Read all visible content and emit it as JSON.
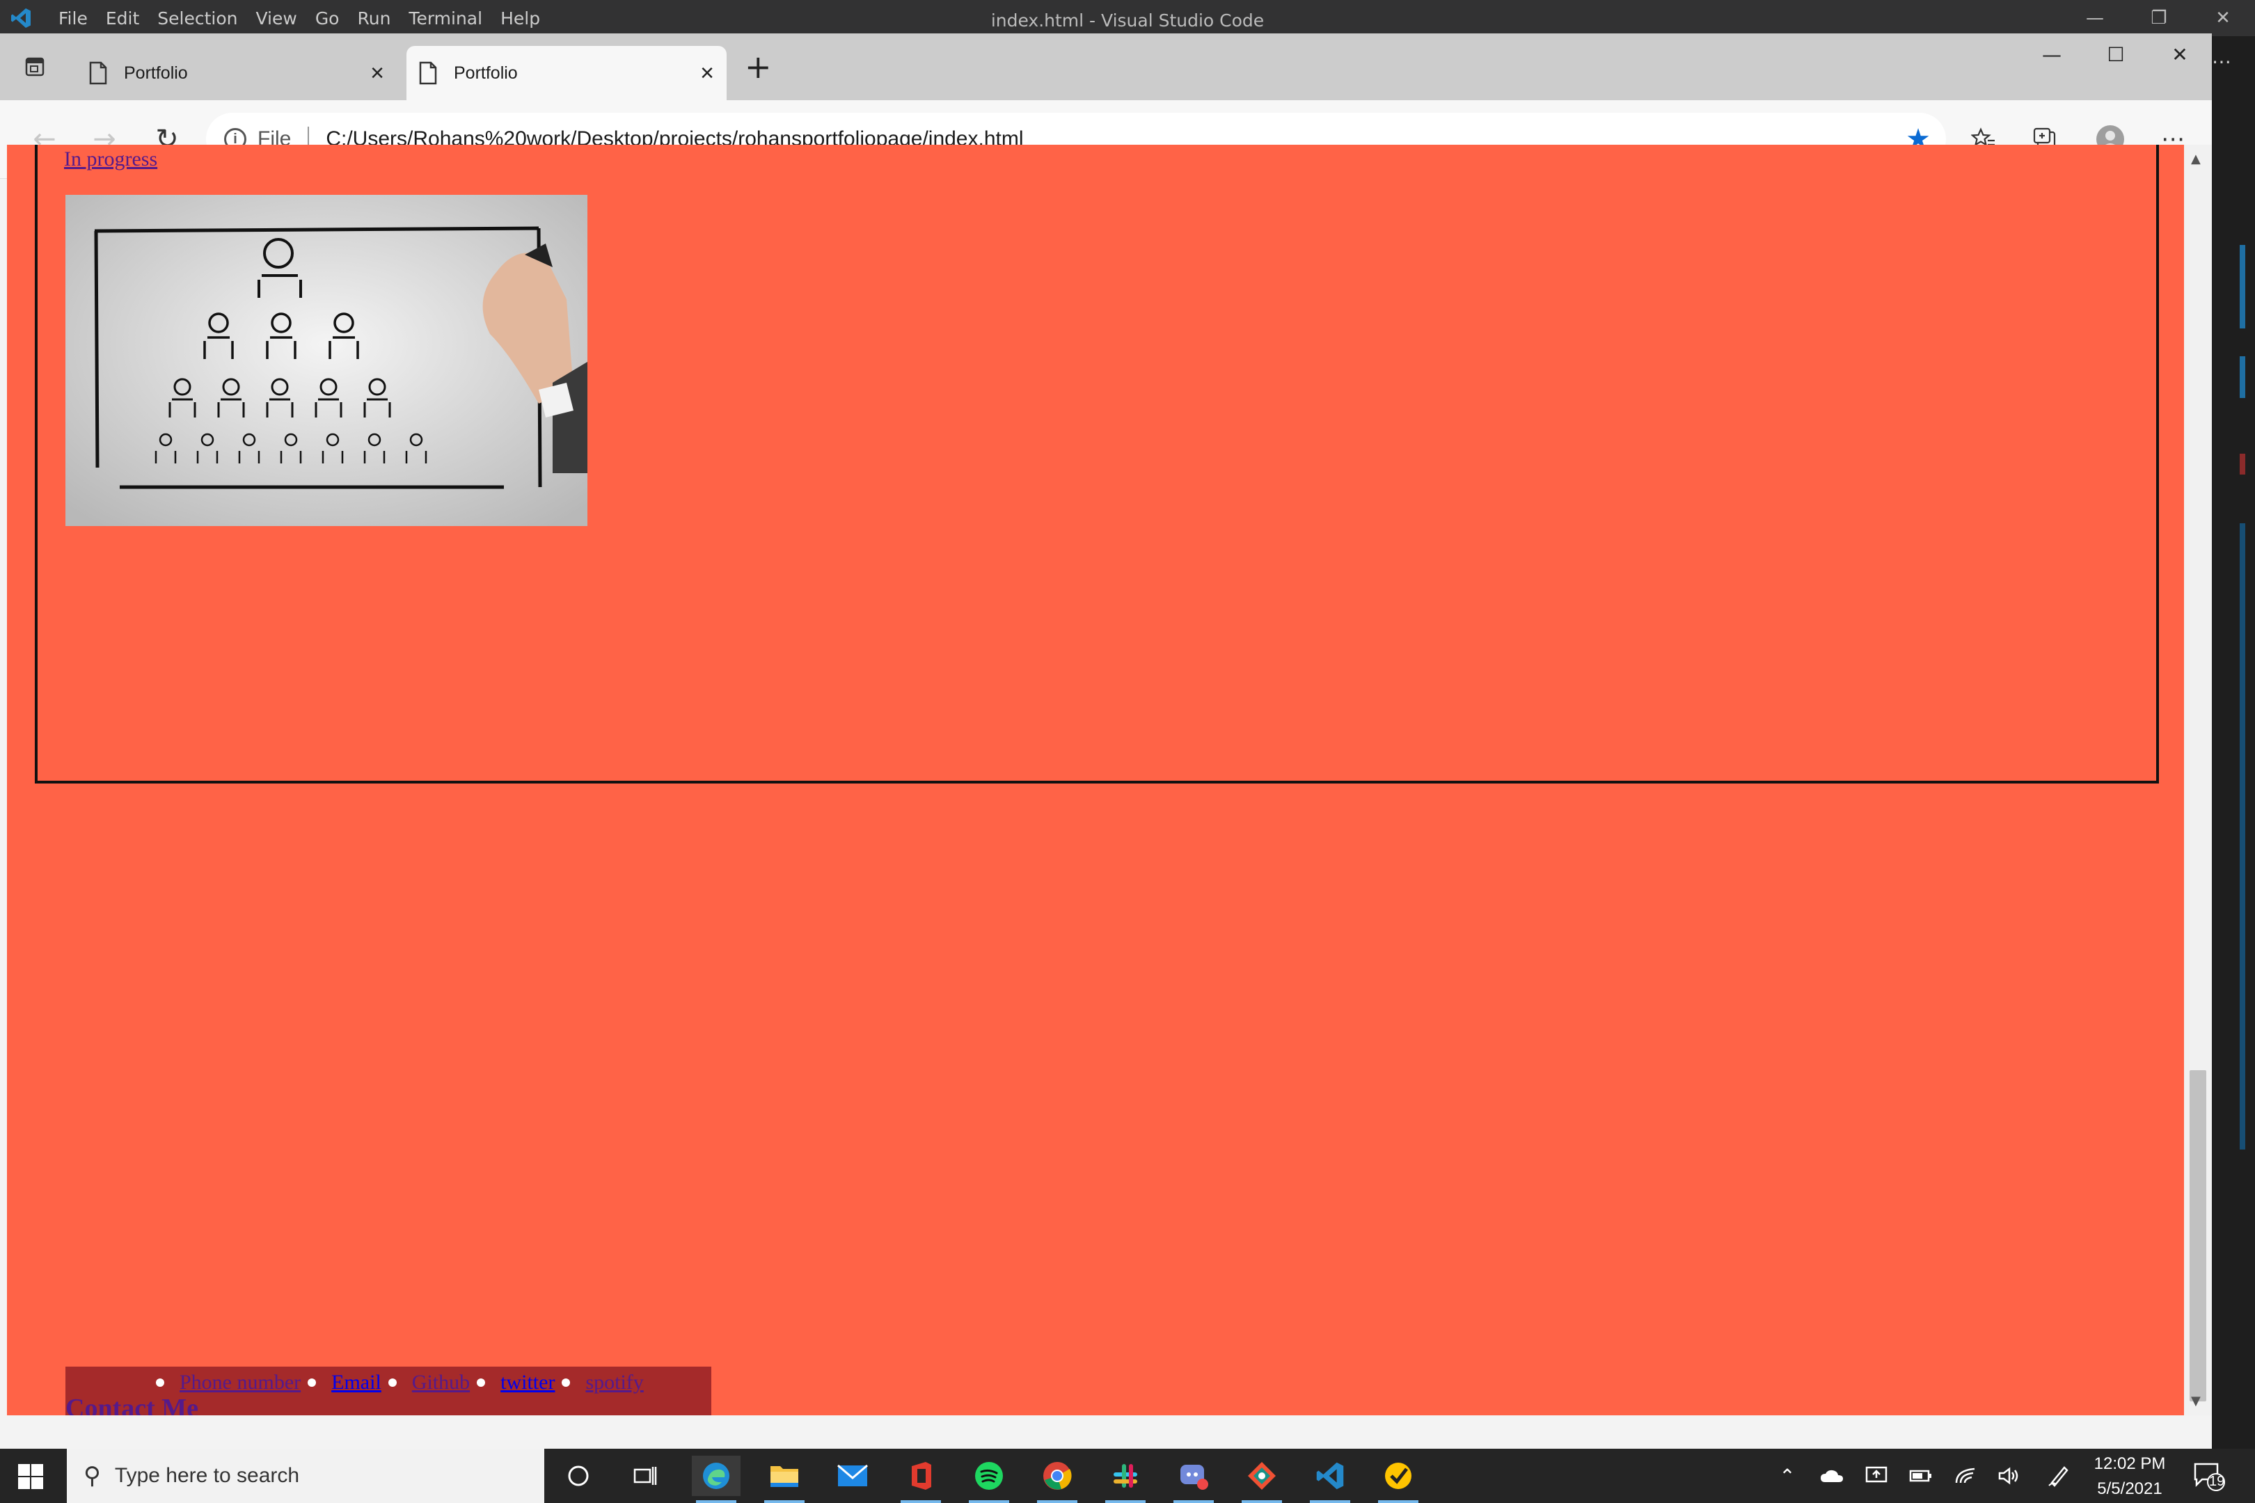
{
  "vscode": {
    "menu": [
      "File",
      "Edit",
      "Selection",
      "View",
      "Go",
      "Run",
      "Terminal",
      "Help"
    ],
    "window_title": "index.html - Visual Studio Code"
  },
  "browser": {
    "tabs": [
      {
        "label": "Portfolio",
        "active": false
      },
      {
        "label": "Portfolio",
        "active": true
      }
    ],
    "address": {
      "scheme_label": "File",
      "url": "C:/Users/Rohans%20work/Desktop/projects/rohansportfoliopage/index.html"
    }
  },
  "page": {
    "background_color": "#ff6347",
    "project_link": "In progress",
    "project_image_alt": "organization chart",
    "footer": {
      "links": [
        {
          "label": "Phone number",
          "visited": true
        },
        {
          "label": "Email",
          "visited": false
        },
        {
          "label": "Github",
          "visited": true
        },
        {
          "label": "twitter",
          "visited": false
        },
        {
          "label": "spotify",
          "visited": true
        }
      ],
      "contact_heading": "Contact Me"
    }
  },
  "taskbar": {
    "search_placeholder": "Type here to search",
    "time": "12:02 PM",
    "date": "5/5/2021",
    "notification_count": "19"
  }
}
